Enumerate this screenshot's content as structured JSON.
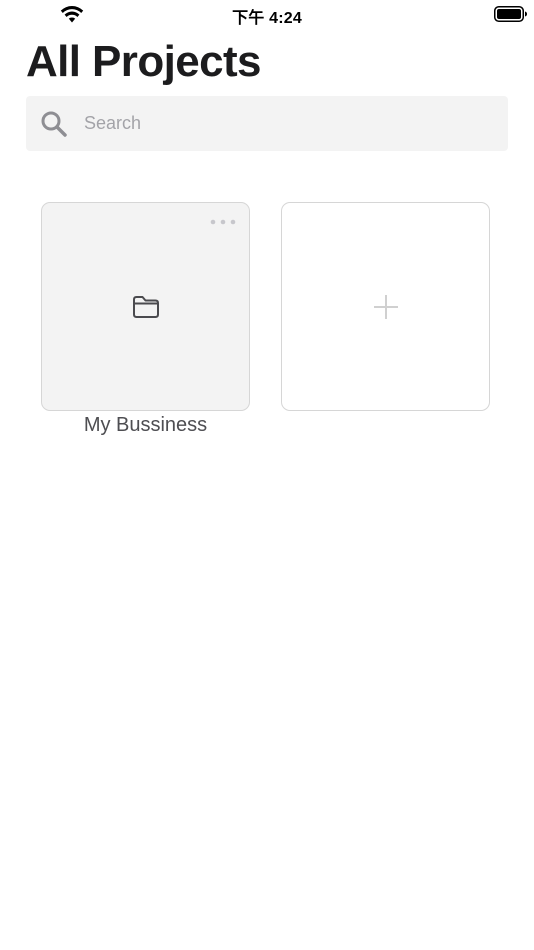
{
  "status_bar": {
    "time": "下午 4:24",
    "wifi_icon": "wifi-icon",
    "battery_icon": "battery-icon"
  },
  "header": {
    "title": "All Projects"
  },
  "search": {
    "placeholder": "Search",
    "value": "",
    "icon": "search-icon"
  },
  "projects": [
    {
      "name": "My Bussiness",
      "icon": "folder-icon",
      "menu_icon": "more-icon"
    }
  ],
  "add_project": {
    "icon": "plus-icon"
  },
  "colors": {
    "background": "#ffffff",
    "search_bg": "#f3f3f3",
    "card_bg": "#f3f3f3",
    "card_border": "#d6d6d6",
    "title_text": "#1c1c1e",
    "placeholder_text": "#a3a3a8",
    "icon_gray": "#8e8e93",
    "plus_gray": "#d0d0d0"
  }
}
